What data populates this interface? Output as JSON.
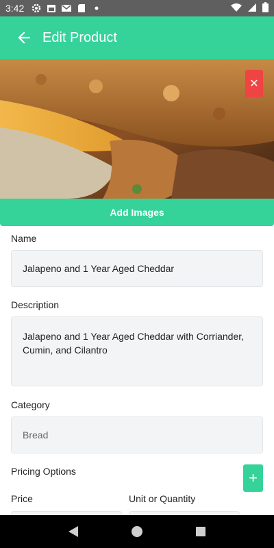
{
  "status_bar": {
    "time": "3:42"
  },
  "app_bar": {
    "title": "Edit Product"
  },
  "images": {
    "remove_label": "✕",
    "add_images_label": "Add Images"
  },
  "form": {
    "name": {
      "label": "Name",
      "value": "Jalapeno and 1 Year Aged Cheddar"
    },
    "description": {
      "label": "Description",
      "value": "Jalapeno and 1 Year Aged Cheddar with Corriander, Cumin, and Cilantro"
    },
    "category": {
      "label": "Category",
      "value": "Bread"
    },
    "pricing": {
      "label": "Pricing Options",
      "add_label": "+",
      "price_label": "Price",
      "unit_label": "Unit or Quantity"
    }
  },
  "colors": {
    "accent": "#35d39a",
    "danger": "#ee4444",
    "status_bar": "#5f5f5f"
  }
}
